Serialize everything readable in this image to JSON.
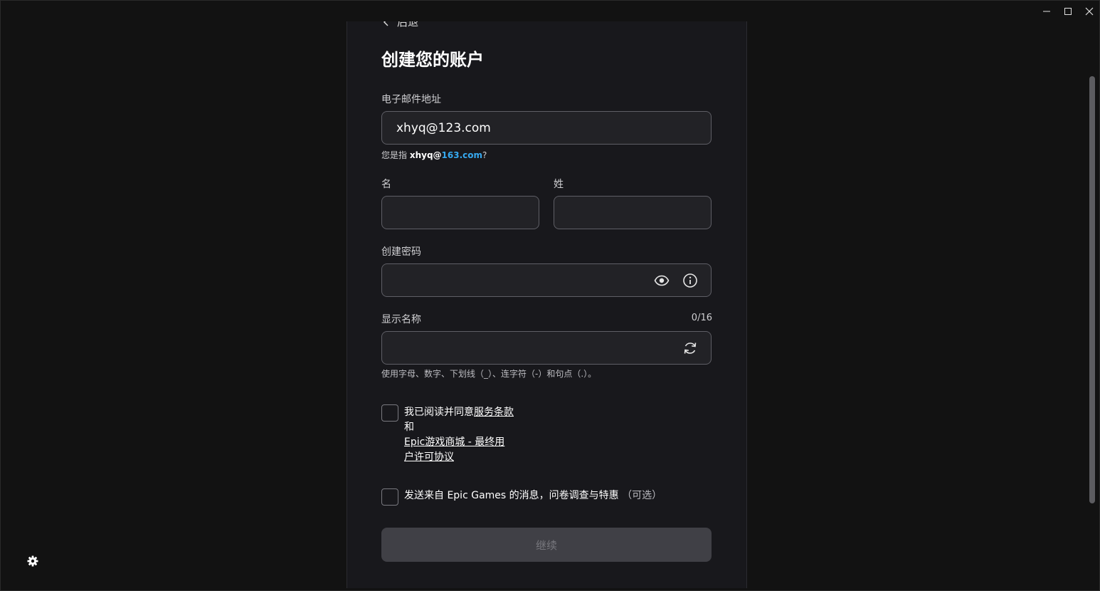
{
  "window": {
    "minimize_icon": "minimize-icon",
    "maximize_icon": "maximize-icon",
    "close_icon": "close-icon"
  },
  "back": {
    "label": "后退"
  },
  "form": {
    "title": "创建您的账户",
    "email": {
      "label": "电子邮件地址",
      "value": "xhyq@123.com",
      "suggestion_prefix": "您是指",
      "suggestion_user": "xhyq@",
      "suggestion_domain": "163.com",
      "suggestion_suffix": "?"
    },
    "first_name": {
      "label": "名",
      "value": ""
    },
    "last_name": {
      "label": "姓",
      "value": ""
    },
    "password": {
      "label": "创建密码",
      "value": ""
    },
    "display_name": {
      "label": "显示名称",
      "value": "",
      "counter": "0/16",
      "hint": "使用字母、数字、下划线（_）、连字符（-）和句点（.）。"
    },
    "terms": {
      "line1_prefix": "我已阅读并同意",
      "line1_link": "服务条款",
      "line2": "和",
      "line3_link": "Epic游戏商城 - 最终用",
      "line4_link": "户许可协议",
      "checked": false
    },
    "marketing": {
      "text": "发送来自 Epic Games 的消息，问卷调查与特惠",
      "optional": "（可选）",
      "checked": false
    },
    "continue_label": "继续"
  },
  "colors": {
    "background": "#121212",
    "panel": "#18181c",
    "field": "#222226",
    "link_accent": "#36a9f0",
    "button_disabled": "#404046"
  }
}
